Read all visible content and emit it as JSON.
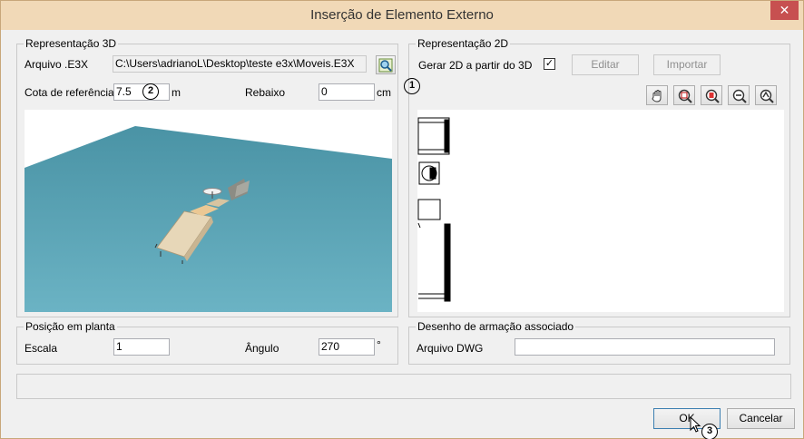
{
  "window": {
    "title": "Inserção de Elemento Externo",
    "close_glyph": "✕"
  },
  "rep3d": {
    "legend": "Representação 3D",
    "arquivo_label": "Arquivo .E3X",
    "arquivo_value": "C:\\Users\\adrianoL\\Desktop\\teste e3x\\Moveis.E3X",
    "cota_label": "Cota de referência",
    "cota_value": "7.5",
    "cota_unit": "m",
    "rebaixo_label": "Rebaixo",
    "rebaixo_value": "0",
    "rebaixo_unit": "cm"
  },
  "rep2d": {
    "legend": "Representação 2D",
    "gerar_label": "Gerar 2D a partir do 3D",
    "gerar_checked": "✓",
    "editar_label": "Editar",
    "importar_label": "Importar",
    "tools": [
      "hand-icon",
      "zoom-window-icon",
      "zoom-extents-icon",
      "zoom-out-icon",
      "zoom-realtime-icon"
    ]
  },
  "posicao": {
    "legend": "Posição em planta",
    "escala_label": "Escala",
    "escala_value": "1",
    "angulo_label": "Ângulo",
    "angulo_value": "270",
    "angulo_unit": "°"
  },
  "armacao": {
    "legend": "Desenho de armação associado",
    "dwg_label": "Arquivo DWG",
    "dwg_value": ""
  },
  "annotations": {
    "one": "1",
    "two": "2",
    "three": "3"
  },
  "footer": {
    "ok_label": "OK",
    "cancel_label": "Cancelar"
  },
  "colors": {
    "floor": "#5aa3b4",
    "titlebar": "#f1d9b7"
  }
}
